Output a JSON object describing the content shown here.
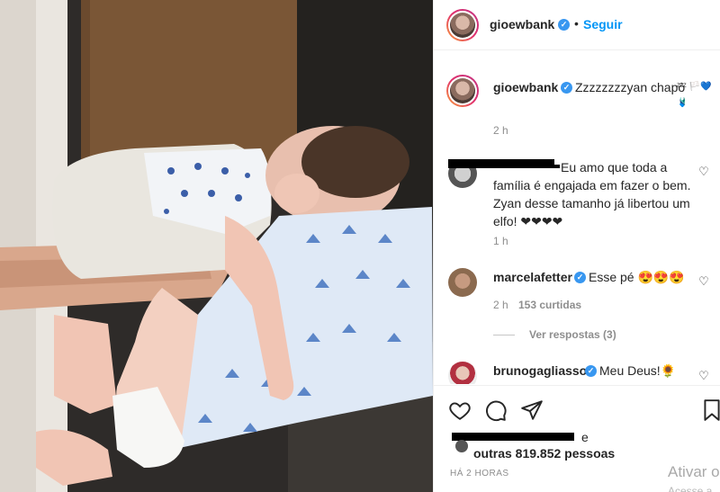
{
  "post": {
    "author": "gioewbank",
    "follow_label": "Seguir",
    "separator": "•",
    "caption_text": "Zzzzzzzzyan chapô",
    "caption_emoji": "ᶻᶻᶻ 🏳️💙🩱",
    "caption_time": "2 h"
  },
  "comments": [
    {
      "user": "",
      "text": "Eu amo que toda a família é engajada em fazer o bem. Zyan desse tamanho já libertou um elfo! ❤❤❤❤",
      "time": "1 h"
    },
    {
      "user": "marcelafetter",
      "text": "Esse pé 😍😍😍",
      "time": "2 h",
      "likes": "153 curtidas",
      "replies": "Ver respostas (3)"
    },
    {
      "user": "brunogagliasso",
      "text": "Meu Deus!🌻"
    }
  ],
  "likes": {
    "prefix_suffix": "e",
    "others": "outras 819.852 pessoas"
  },
  "timestamp": "HÁ 2 HORAS",
  "watermark": {
    "line1": "Ativar o",
    "line2": "Acesse a"
  },
  "icons": {
    "like": "heart-outline-icon",
    "comment": "speech-bubble-icon",
    "share": "paper-plane-icon",
    "save": "bookmark-icon",
    "more": "more-horizontal-icon"
  },
  "colors": {
    "accent": "#0095f6",
    "verified": "#3897f0",
    "text": "#262626",
    "secondary": "#8e8e8e"
  }
}
